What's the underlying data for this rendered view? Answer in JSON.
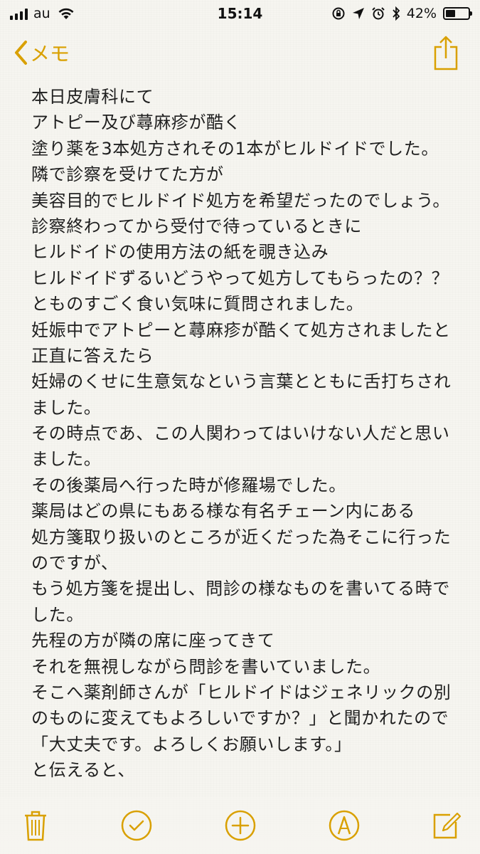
{
  "status_bar": {
    "carrier": "au",
    "time": "15:14",
    "battery_percent": "42%",
    "battery_level": 0.42
  },
  "nav": {
    "back_label": "メモ",
    "accent_color": "#d9a000"
  },
  "note": {
    "lines": [
      "本日皮膚科にて",
      "アトピー及び蕁麻疹が酷く",
      "塗り薬を3本処方されその1本がヒルドイドでした。",
      "隣で診察を受けてた方が",
      "美容目的でヒルドイド処方を希望だったのでしょう。",
      "診察終わってから受付で待っているときに",
      "ヒルドイドの使用方法の紙を覗き込み",
      "ヒルドイドずるいどうやって処方してもらったの？？",
      "とものすごく食い気味に質問されました。",
      "妊娠中でアトピーと蕁麻疹が酷くて処方されましたと",
      "正直に答えたら",
      "妊婦のくせに生意気なという言葉とともに舌打ちされ",
      "ました。",
      "その時点であ、この人関わってはいけない人だと思い",
      "ました。",
      "その後薬局へ行った時が修羅場でした。",
      "薬局はどの県にもある様な有名チェーン内にある",
      "処方箋取り扱いのところが近くだった為そこに行った",
      "のですが、",
      "もう処方箋を提出し、問診の様なものを書いてる時で",
      "した。",
      "先程の方が隣の席に座ってきて",
      "それを無視しながら問診を書いていました。",
      "そこへ薬剤師さんが「ヒルドイドはジェネリックの別",
      "のものに変えてもよろしいですか？」と聞かれたので",
      "「大丈夫です。よろしくお願いします。」",
      "と伝えると、"
    ]
  },
  "toolbar": {
    "icons": [
      "trash-icon",
      "checklist-icon",
      "add-icon",
      "pen-icon",
      "compose-icon"
    ]
  }
}
